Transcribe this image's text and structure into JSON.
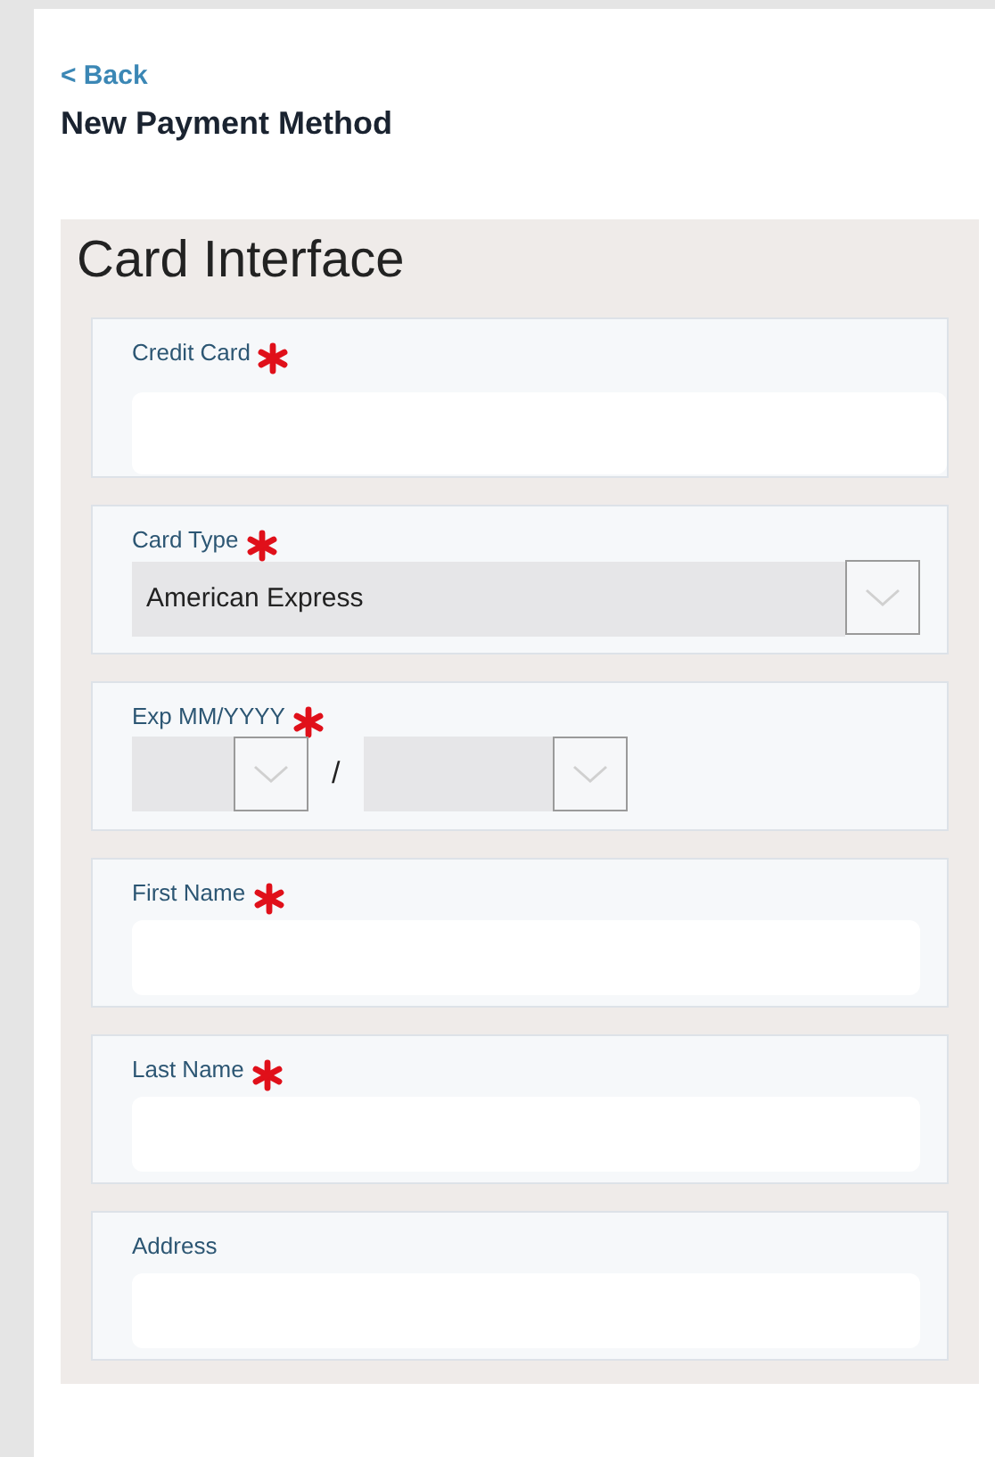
{
  "back_link": "< Back",
  "page_title": "New Payment Method",
  "panel": {
    "title": "Card Interface",
    "fields": [
      {
        "kind": "text",
        "label": "Credit Card",
        "required": true,
        "wide": true
      },
      {
        "kind": "select",
        "label": "Card Type",
        "required": true,
        "value": "American Express"
      },
      {
        "kind": "expiry",
        "label": "Exp MM/YYYY",
        "required": true,
        "separator": "/"
      },
      {
        "kind": "text",
        "label": "First Name",
        "required": true
      },
      {
        "kind": "text",
        "label": "Last Name",
        "required": true
      },
      {
        "kind": "text",
        "label": "Address",
        "required": false
      }
    ]
  }
}
